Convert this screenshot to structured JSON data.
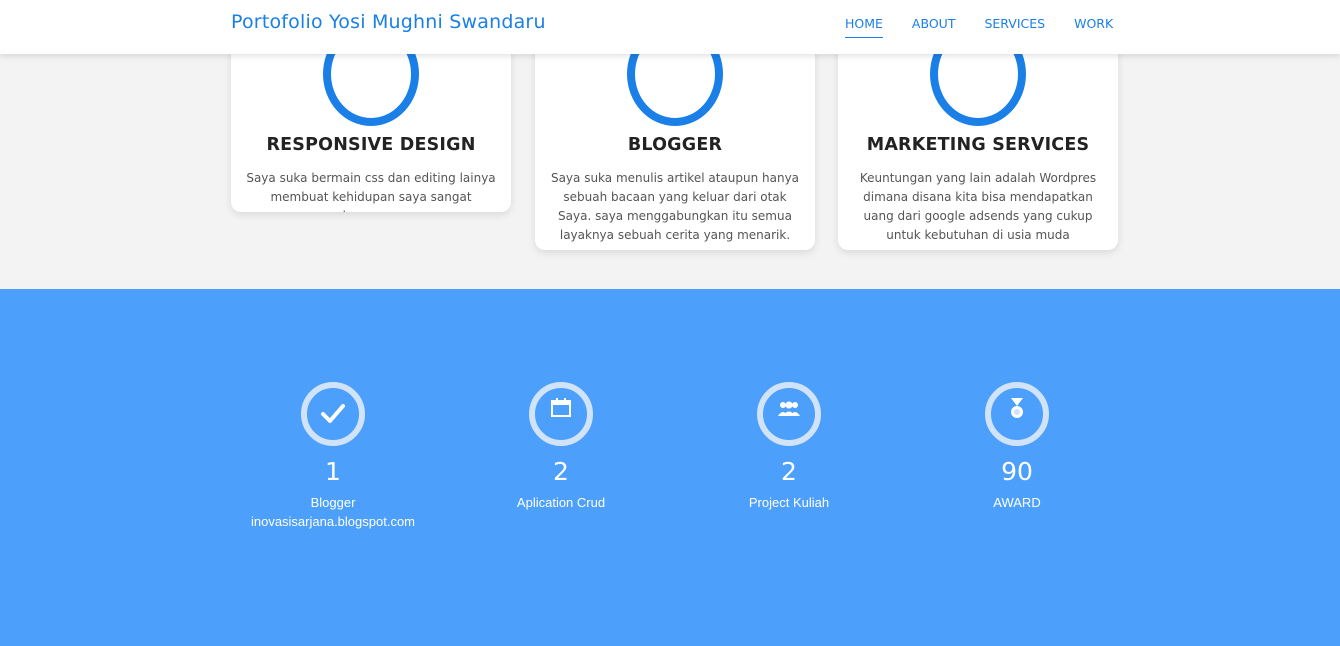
{
  "navbar": {
    "brand": "Portofolio Yosi Mughni Swandaru",
    "links": [
      "HOME",
      "ABOUT",
      "SERVICES",
      "WORK"
    ],
    "active": "HOME"
  },
  "services": [
    {
      "title": "RESPONSIVE DESIGN",
      "text": "Saya suka bermain css dan editing lainya membuat kehidupan saya sangat berwarna"
    },
    {
      "title": "BLOGGER",
      "text": "Saya suka menulis artikel ataupun hanya sebuah bacaan yang keluar dari otak Saya. saya menggabungkan itu semua layaknya sebuah cerita yang menarik."
    },
    {
      "title": "MARKETING SERVICES",
      "text": "Keuntungan yang lain adalah Wordpres dimana disana kita bisa mendapatkan uang dari google adsends yang cukup untuk kebutuhan di usia muda"
    }
  ],
  "stats": [
    {
      "icon": "check-icon",
      "number": "1",
      "label_line1": "Blogger",
      "label_line2": "inovasisarjana.blogspot.com"
    },
    {
      "icon": "calendar-icon",
      "number": "2",
      "label_line1": "Aplication Crud",
      "label_line2": ""
    },
    {
      "icon": "users-icon",
      "number": "2",
      "label_line1": "Project Kuliah",
      "label_line2": ""
    },
    {
      "icon": "medal-icon",
      "number": "90",
      "label_line1": "AWARD",
      "label_line2": ""
    }
  ],
  "colors": {
    "accent": "#1a7fe6",
    "stats_background": "#4c9ffb",
    "page_background": "#f3f3f3",
    "ring_light": "#d0e3f8"
  }
}
